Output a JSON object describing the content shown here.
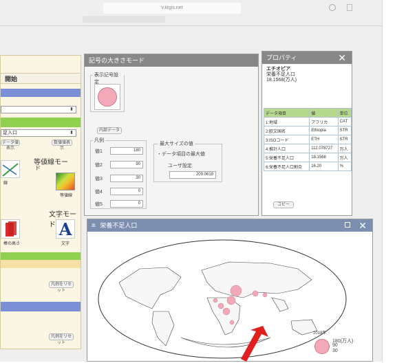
{
  "browser": {
    "url": "v.ktgis.net"
  },
  "left_panel": {
    "start_label": "開始",
    "select_value": "",
    "dropdown_value": "足入口",
    "mini_btn1": "データ値表示",
    "mini_btn2": "数値値表示",
    "contour_label": "等値線モー",
    "contour_label2": "ド",
    "contour_caption": "等値線",
    "text_mode_label": "文字モード",
    "text_caption": "文字",
    "bar_caption": "棒の高さ",
    "line_caption": "線",
    "reset1": "凡例をリセット",
    "reset2": "凡例をリセット"
  },
  "symbol_panel": {
    "title": "記号の大きさモード",
    "display_label": "表示記号設定",
    "inner_data_btn": "内部データ",
    "legend_label": "凡例",
    "legend_rows": [
      {
        "label": "値1",
        "value": "180"
      },
      {
        "label": "値2",
        "value": "90"
      },
      {
        "label": "値3",
        "value": "30"
      },
      {
        "label": "値4",
        "value": "0"
      },
      {
        "label": "値5",
        "value": "0"
      }
    ],
    "max_size_label": "最大サイズの値",
    "data_max_option": "データ項目の最大値",
    "user_setting_option": "ユーザ設定",
    "user_value": "209.0619"
  },
  "properties": {
    "title": "プロパティ",
    "heading_line1": "エチオピア",
    "heading_line2": "栄養不足人口",
    "heading_line3": "18.1568(万人)",
    "columns": [
      "データ項目",
      "値",
      "単位"
    ],
    "rows": [
      [
        "1:地域",
        "アフリカ",
        "CAT"
      ],
      [
        "2:欧文国名",
        "Ethiopia",
        "STR"
      ],
      [
        "3:ISOコード",
        "ETH",
        "STR"
      ],
      [
        "4:推計人口",
        "112.078727",
        "万人"
      ],
      [
        "5:栄養不足人口",
        "18.1568",
        "万人"
      ],
      [
        "6:栄養不足人口割合",
        "16.20",
        "%"
      ]
    ],
    "copy_btn": "コピー"
  },
  "map_window": {
    "title": "栄養不足人口",
    "legend_year": "2018年",
    "legend_values": [
      "180(万人)",
      "90",
      "30"
    ]
  },
  "colors": {
    "accent_blue": "#7b8fd6",
    "accent_green": "#8fd14f",
    "symbol_pink": "#f2a9b8",
    "arrow_red": "#e01f1f"
  }
}
